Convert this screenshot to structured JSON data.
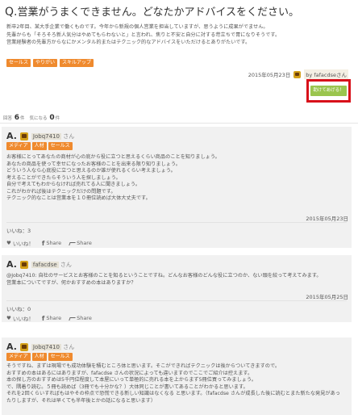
{
  "question": {
    "mark": "Q.",
    "title": "営業がうまくできません。どなたかアドバイスをください。",
    "body": [
      "新卒2年目、某大手企業で働くものです。今年から新規の個人営業を担当していますが、思うように成果がでません。",
      "先輩からも「そろそろ新人気分はやめてもらわないと」と言われ、焦りと不安と自分に対する苛立ちで胃になりそうです。",
      "営業経験者の先輩方からなにかメンタル的またはテクニック的なアドバイスをいただけるとありがたいです。"
    ],
    "tags": [
      "セールス",
      "やりがい",
      "スキルアップ"
    ],
    "date": "2015年05月23日",
    "author_prefix": "by",
    "author": "fafacdse",
    "author_suffix": "さん",
    "help_button": "助けてあげる！"
  },
  "counts": {
    "answers_label": "回答",
    "answers_value": "6",
    "answers_unit": "件",
    "interest_label": "気になる",
    "interest_value": "0",
    "interest_unit": "件"
  },
  "answers": [
    {
      "letter": "A.",
      "name": "Jobq7410",
      "suffix": "さん",
      "tags": [
        "メディア",
        "人材",
        "セールス"
      ],
      "text": [
        "お客様にとってあなたの商材が心の底から役に立つと思えるくらい商品のことを知りましょう。",
        "あなたの商品を使って幸せになったお客様のことを出来る限り知りましょう。",
        "どういう人なら心底役に立つと思えるのか誰が使れるくらい考えましょう。",
        "考えることができたらそういう人を探しましょう。",
        "自分で考えてもわからなければ売れてる人に聞きましょう。",
        "これがわかれば後はテクニックだけの問題です。",
        "テクニック的なことは営業本を１０冊位読めば大体大丈夫です。"
      ],
      "date": "2015年05月23日",
      "likes": "いいね：3",
      "like_btn": "いいね！",
      "fb_share": "Share",
      "share": "Share"
    },
    {
      "letter": "A.",
      "name": "fafacdse",
      "suffix": "さん",
      "text": [
        "@Jobq7410: 自社のサービスとお客様のことを知るということですね。どんなお客様のどんな役に立つのか、ない頭を絞って考えてみます。",
        "営業本についてですが、何かおすすめの本はありますか？"
      ],
      "date": "2015年05月25日",
      "likes": "いいね：0",
      "like_btn": "いいね！",
      "fb_share": "Share",
      "share": "Share"
    },
    {
      "letter": "A.",
      "name": "Jobq7410",
      "suffix": "さん",
      "tags": [
        "メディア",
        "人材",
        "セールス"
      ],
      "text": [
        "そうですね、まずは現場でも成功体験を積むところ体と思います。そこができればテクニックは後からついてきますので。",
        "おすすめの本はあるにはありますが、fafacdse さんの状況によっても違いますのでここでご紹介は控えます。",
        "本の探し方のおすすめは5千円位程度して本屋にいって単極的に売れる本を上からまず5冊位買ってみましょう。",
        "で、隅着り読む。５冊も読めば（3冊でも十分かな？）大体同じことが書いてあることがわかると思います。",
        "それを2回くらいすればもはやその枠点で恐慌できる新しい知識はなくなる と思います。（fafacdse さんが成長した後に読むとまた新たな発見があったりしますが、それは早くても半年後とかの話になると思います）"
      ]
    }
  ]
}
